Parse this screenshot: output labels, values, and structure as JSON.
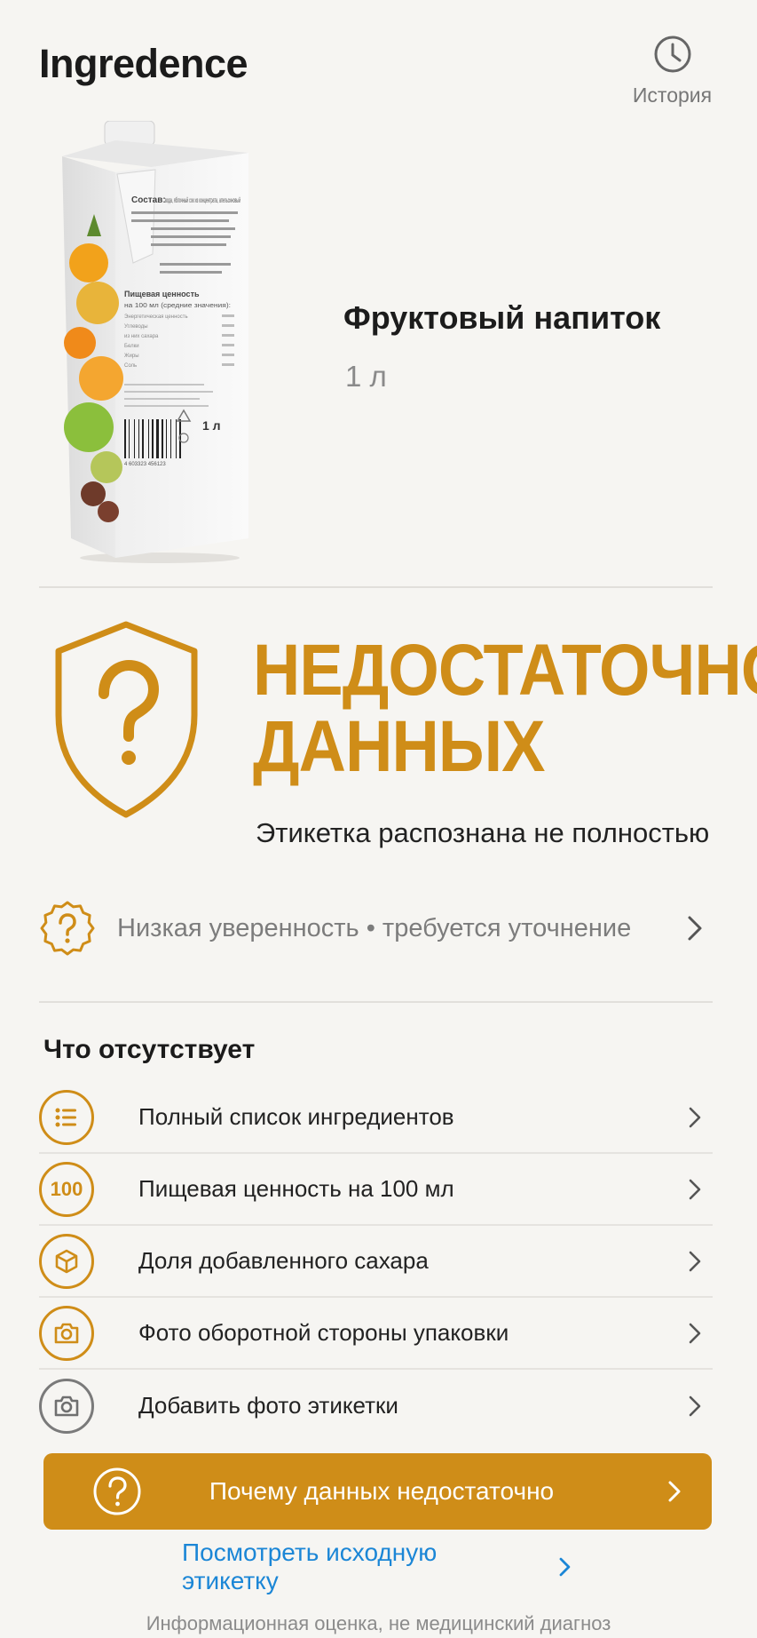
{
  "header": {
    "app_title": "Ingredence",
    "history_label": "История"
  },
  "product": {
    "name": "Фруктовый напиток",
    "volume": "1 л",
    "package": {
      "composition_label": "Состав:",
      "composition_text": "вода, яблочный сок из концентрата, апельсиновый",
      "nutrition_title": "Пищевая ценность",
      "nutrition_subtitle": "на 100 мл (средние значения):",
      "nutrition_rows": [
        "Энергетическая ценность",
        "Углеводы",
        "из них сахара",
        "Белки",
        "Жиры",
        "Соль"
      ],
      "volume_mark": "1 л",
      "barcode": "4 603323 456123"
    }
  },
  "status": {
    "title_line1": "НЕДОСТАТОЧНО",
    "title_line2": "ДАННЫХ",
    "subtitle": "Этикетка распознана не полностью",
    "color": "#cf8d18"
  },
  "confidence": {
    "text": "Низкая уверенность • требуется уточнение",
    "icon": "question-badge-icon"
  },
  "missing": {
    "title": "Что отсутствует",
    "items": [
      {
        "label": "Полный список ингредиентов",
        "icon": "list-icon"
      },
      {
        "label": "Пищевая ценность на 100 мл",
        "icon": "100",
        "icon_text": "100"
      },
      {
        "label": "Доля добавленного сахара",
        "icon": "cube-icon"
      },
      {
        "label": "Фото оборотной стороны упаковки",
        "icon": "camera-icon"
      },
      {
        "label": "Добавить фото этикетки",
        "icon": "camera-icon"
      }
    ]
  },
  "cta": {
    "label": "Почему данных недостаточно"
  },
  "link": {
    "label": "Посмотреть исходную этикетку"
  },
  "footer": {
    "disclaimer": "Информационная оценка, не медицинский диагноз"
  }
}
